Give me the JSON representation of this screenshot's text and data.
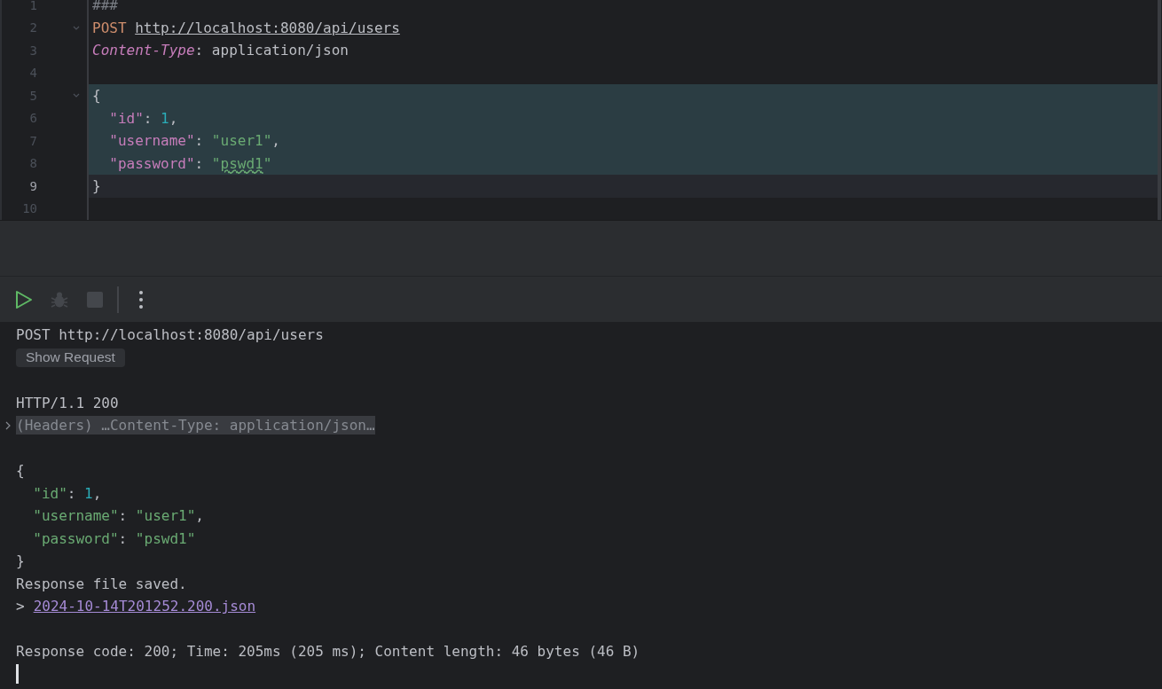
{
  "editor": {
    "lines": [
      {
        "number": "1",
        "fold": false,
        "highlighted": false,
        "current": false,
        "tokens": [
          {
            "kind": "comment",
            "text": "###"
          }
        ]
      },
      {
        "number": "2",
        "fold": true,
        "highlighted": false,
        "current": false,
        "tokens": [
          {
            "kind": "method",
            "text": "POST "
          },
          {
            "kind": "url",
            "text": "http://localhost:8080/api/users"
          }
        ]
      },
      {
        "number": "3",
        "fold": false,
        "highlighted": false,
        "current": false,
        "tokens": [
          {
            "kind": "header",
            "text": "Content-Type"
          },
          {
            "kind": "plain",
            "text": ": application/json"
          }
        ]
      },
      {
        "number": "4",
        "fold": false,
        "highlighted": false,
        "current": false
      },
      {
        "number": "5",
        "fold": true,
        "highlighted": true,
        "current": false,
        "tokens": [
          {
            "kind": "plain",
            "text": "{"
          }
        ]
      },
      {
        "number": "6",
        "fold": false,
        "highlighted": true,
        "current": false,
        "tokens": [
          {
            "kind": "key",
            "text": "  \"id\""
          },
          {
            "kind": "plain",
            "text": ": "
          },
          {
            "kind": "number",
            "text": "1"
          },
          {
            "kind": "plain",
            "text": ","
          }
        ]
      },
      {
        "number": "7",
        "fold": false,
        "highlighted": true,
        "current": false,
        "tokens": [
          {
            "kind": "key",
            "text": "  \"username\""
          },
          {
            "kind": "plain",
            "text": ": "
          },
          {
            "kind": "string",
            "text": "\"user1\""
          },
          {
            "kind": "plain",
            "text": ","
          }
        ]
      },
      {
        "number": "8",
        "fold": false,
        "highlighted": true,
        "current": false,
        "tokens": [
          {
            "kind": "key",
            "text": "  \"password\""
          },
          {
            "kind": "plain",
            "text": ": "
          },
          {
            "kind": "string",
            "text": "\""
          },
          {
            "kind": "typo",
            "text": "pswd1"
          },
          {
            "kind": "string",
            "text": "\""
          }
        ]
      },
      {
        "number": "9",
        "fold": false,
        "highlighted": false,
        "current": true,
        "tokens": [
          {
            "kind": "plain",
            "text": "}"
          }
        ]
      },
      {
        "number": "10",
        "fold": false,
        "highlighted": false,
        "current": false
      }
    ]
  },
  "toolbar": [
    {
      "kind": "run",
      "disabled": false
    },
    {
      "kind": "debug",
      "disabled": true
    },
    {
      "kind": "stop",
      "disabled": true
    },
    {
      "kind": "more",
      "disabled": false
    }
  ],
  "output": {
    "lines": [
      {
        "kind": "text",
        "text": "POST http://localhost:8080/api/users"
      },
      {
        "kind": "button",
        "text": "Show Request"
      },
      {
        "kind": "blank"
      },
      {
        "kind": "text",
        "text": "HTTP/1.1 200"
      },
      {
        "kind": "collapsed",
        "expanded": false,
        "text": "(Headers) …Content-Type: application/json…"
      },
      {
        "kind": "blank"
      },
      {
        "kind": "code",
        "tokens": [
          {
            "kind": "plain",
            "text": "{"
          }
        ]
      },
      {
        "kind": "code",
        "tokens": [
          {
            "kind": "string",
            "text": "  \"id\""
          },
          {
            "kind": "plain",
            "text": ": "
          },
          {
            "kind": "number",
            "text": "1"
          },
          {
            "kind": "plain",
            "text": ","
          }
        ]
      },
      {
        "kind": "code",
        "tokens": [
          {
            "kind": "string",
            "text": "  \"username\""
          },
          {
            "kind": "plain",
            "text": ": "
          },
          {
            "kind": "string",
            "text": "\"user1\""
          },
          {
            "kind": "plain",
            "text": ","
          }
        ]
      },
      {
        "kind": "code",
        "tokens": [
          {
            "kind": "string",
            "text": "  \"password\""
          },
          {
            "kind": "plain",
            "text": ": "
          },
          {
            "kind": "string",
            "text": "\"pswd1\""
          }
        ]
      },
      {
        "kind": "code",
        "tokens": [
          {
            "kind": "plain",
            "text": "}"
          }
        ]
      },
      {
        "kind": "text",
        "text": "Response file saved."
      },
      {
        "kind": "link",
        "prefix": ">",
        "text": "2024-10-14T201252.200.json"
      },
      {
        "kind": "blank"
      },
      {
        "kind": "text",
        "text": "Response code: 200; Time: 205ms (205 ms); Content length: 46 bytes (46 B)"
      },
      {
        "kind": "cursor"
      }
    ]
  }
}
